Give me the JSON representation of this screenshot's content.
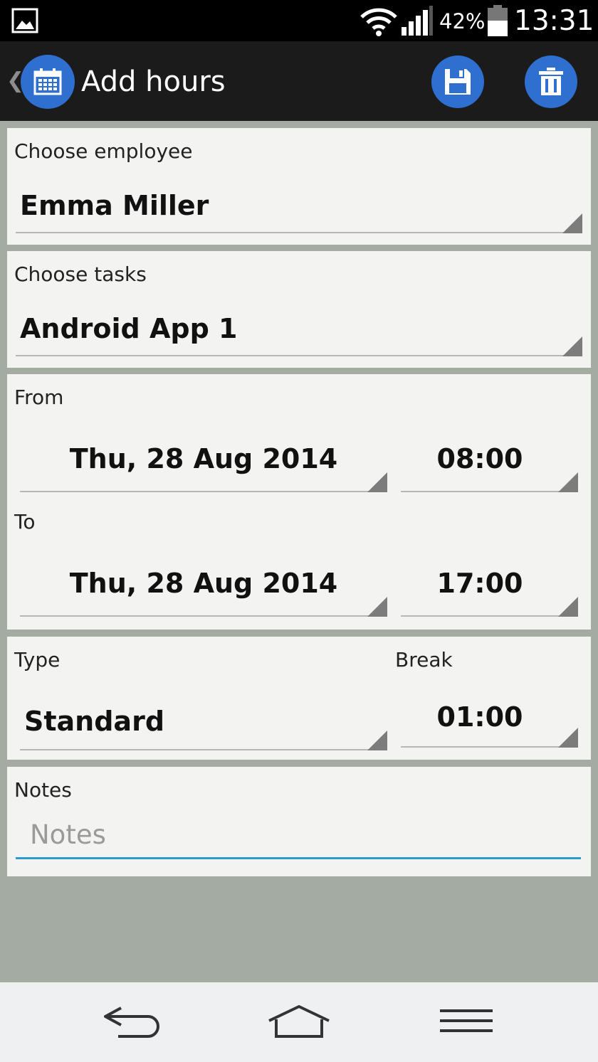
{
  "status_bar": {
    "battery_percent": "42%",
    "time": "13:31",
    "icons": [
      "gallery-icon",
      "wifi-icon",
      "signal-icon",
      "battery-icon"
    ]
  },
  "action_bar": {
    "title": "Add hours",
    "icons": [
      "calendar-icon",
      "save-icon",
      "trash-icon"
    ]
  },
  "employee": {
    "label": "Choose employee",
    "value": "Emma Miller"
  },
  "task": {
    "label": "Choose tasks",
    "value": "Android App 1"
  },
  "from": {
    "label": "From",
    "date": "Thu, 28 Aug 2014",
    "time": "08:00"
  },
  "to": {
    "label": "To",
    "date": "Thu, 28 Aug 2014",
    "time": "17:00"
  },
  "type": {
    "label": "Type",
    "value": "Standard"
  },
  "break": {
    "label": "Break",
    "value": "01:00"
  },
  "notes": {
    "label": "Notes",
    "placeholder": "Notes",
    "value": ""
  },
  "nav_bar": {
    "icons": [
      "back-icon",
      "home-icon",
      "menu-icon"
    ]
  },
  "colors": {
    "accent": "#2e6fd0",
    "focus_underline": "#2b9ad0",
    "card_bg": "#f3f3f1",
    "page_bg": "#a3aba3"
  }
}
